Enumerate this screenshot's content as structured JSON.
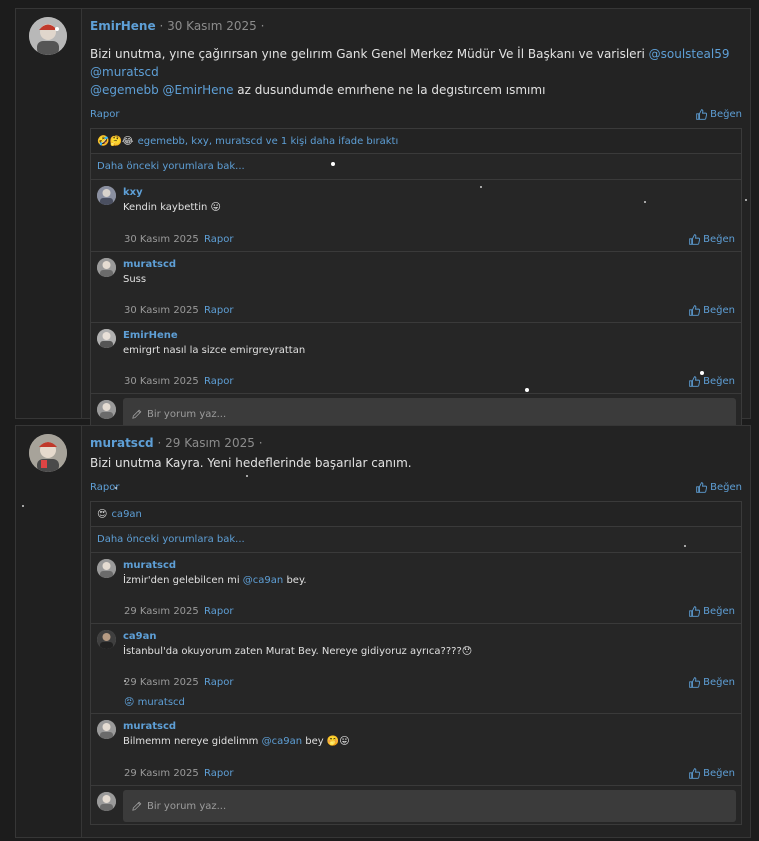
{
  "posts": [
    {
      "user": "EmirHene",
      "date": "30 Kasım 2025",
      "text_parts": [
        {
          "t": "Bizi unutma, yıne çağırırsan yıne gelırım Gank Genel Merkez Müdür Ve İl Başkanı ve varisleri ",
          "m": false
        },
        {
          "t": "@soulsteal59",
          "m": true
        },
        {
          "t": " ",
          "m": false
        },
        {
          "t": "@muratscd",
          "m": true
        },
        {
          "t": " ",
          "m": false
        },
        {
          "t": "@egemebb",
          "m": true
        },
        {
          "t": " ",
          "m": false
        },
        {
          "t": "@EmirHene",
          "m": true
        },
        {
          "t": " az dusundumde emırhene ne la degıstırcem ısmımı",
          "m": false
        }
      ],
      "report_label": "Rapor",
      "like_label": "Beğen",
      "reactions_emojis": "🤣🤔😂",
      "reactions_text": "egemebb, kxy, muratscd ve 1 kişi daha ifade bıraktı",
      "more_comments": "Daha önceki yorumlara bak...",
      "comments": [
        {
          "user": "kxy",
          "text": "Kendin kaybettin 😛",
          "date": "30 Kasım 2025",
          "report": "Rapor",
          "like": "Beğen",
          "reaction": ""
        },
        {
          "user": "muratscd",
          "text": "Suss",
          "date": "30 Kasım 2025",
          "report": "Rapor",
          "like": "Beğen",
          "reaction": ""
        },
        {
          "user": "EmirHene",
          "text": "emirgrt nasıl la sizce emirgreyrattan",
          "date": "30 Kasım 2025",
          "report": "Rapor",
          "like": "Beğen",
          "reaction": ""
        }
      ],
      "reply_placeholder": "Bir yorum yaz..."
    },
    {
      "user": "muratscd",
      "date": "29 Kasım 2025",
      "text_parts": [
        {
          "t": "Bizi unutma Kayra. Yeni hedeflerinde başarılar canım.",
          "m": false
        }
      ],
      "report_label": "Rapor",
      "like_label": "Beğen",
      "reactions_emojis": "😍",
      "reactions_text": "ca9an",
      "more_comments": "Daha önceki yorumlara bak...",
      "comments": [
        {
          "user": "muratscd",
          "text_parts": [
            {
              "t": "İzmir'den gelebilcen mi ",
              "m": false
            },
            {
              "t": "@ca9an",
              "m": true
            },
            {
              "t": " bey.",
              "m": false
            }
          ],
          "date": "29 Kasım 2025",
          "report": "Rapor",
          "like": "Beğen",
          "reaction": ""
        },
        {
          "user": "ca9an",
          "text": "İstanbul'da okuyorum zaten Murat Bey. Nereye gidiyoruz ayrıca????😯",
          "date": "29 Kasım 2025",
          "report": "Rapor",
          "like": "Beğen",
          "reaction": "😡 muratscd"
        },
        {
          "user": "muratscd",
          "text_parts": [
            {
              "t": "Bilmemm nereye gidelimm ",
              "m": false
            },
            {
              "t": "@ca9an",
              "m": true
            },
            {
              "t": " bey 🤭😛",
              "m": false
            }
          ],
          "date": "29 Kasım 2025",
          "report": "Rapor",
          "like": "Beğen",
          "reaction": ""
        }
      ],
      "reply_placeholder": "Bir yorum yaz..."
    }
  ],
  "colors": {
    "accent": "#5e9fd6",
    "background": "#1c1c1c",
    "panel": "#232323"
  },
  "icons": {
    "like": "thumbs-up-icon",
    "pencil": "pencil-icon"
  }
}
